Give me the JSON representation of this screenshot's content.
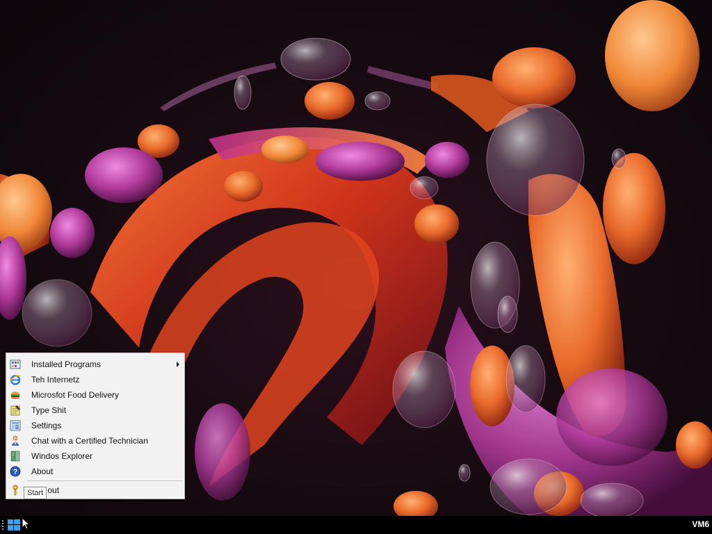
{
  "desktop": {
    "wallpaper": "abstract-glass-bubbles",
    "colors": {
      "orange": "#e8692a",
      "magenta": "#b03a9a",
      "dark": "#140a10"
    }
  },
  "start_menu": {
    "items": [
      {
        "label": "Installed Programs",
        "icon": "programs-icon",
        "has_submenu": true
      },
      {
        "label": "Teh Internetz",
        "icon": "internet-explorer-icon",
        "has_submenu": false
      },
      {
        "label": "Microsfot Food Delivery",
        "icon": "burger-icon",
        "has_submenu": false
      },
      {
        "label": "Type Shit",
        "icon": "notepad-icon",
        "has_submenu": false
      },
      {
        "label": "Settings",
        "icon": "settings-icon",
        "has_submenu": false
      },
      {
        "label": "Chat with a Certified Technician",
        "icon": "technician-icon",
        "has_submenu": false
      },
      {
        "label": "Windos Explorer",
        "icon": "explorer-icon",
        "has_submenu": false
      },
      {
        "label": "About",
        "icon": "help-icon",
        "has_submenu": false
      }
    ],
    "logout": {
      "label": "Log out",
      "icon": "key-icon"
    }
  },
  "tooltip": {
    "text": "Start"
  },
  "taskbar": {
    "start_icon": "windows-logo-icon",
    "tray_label": "VM6"
  }
}
